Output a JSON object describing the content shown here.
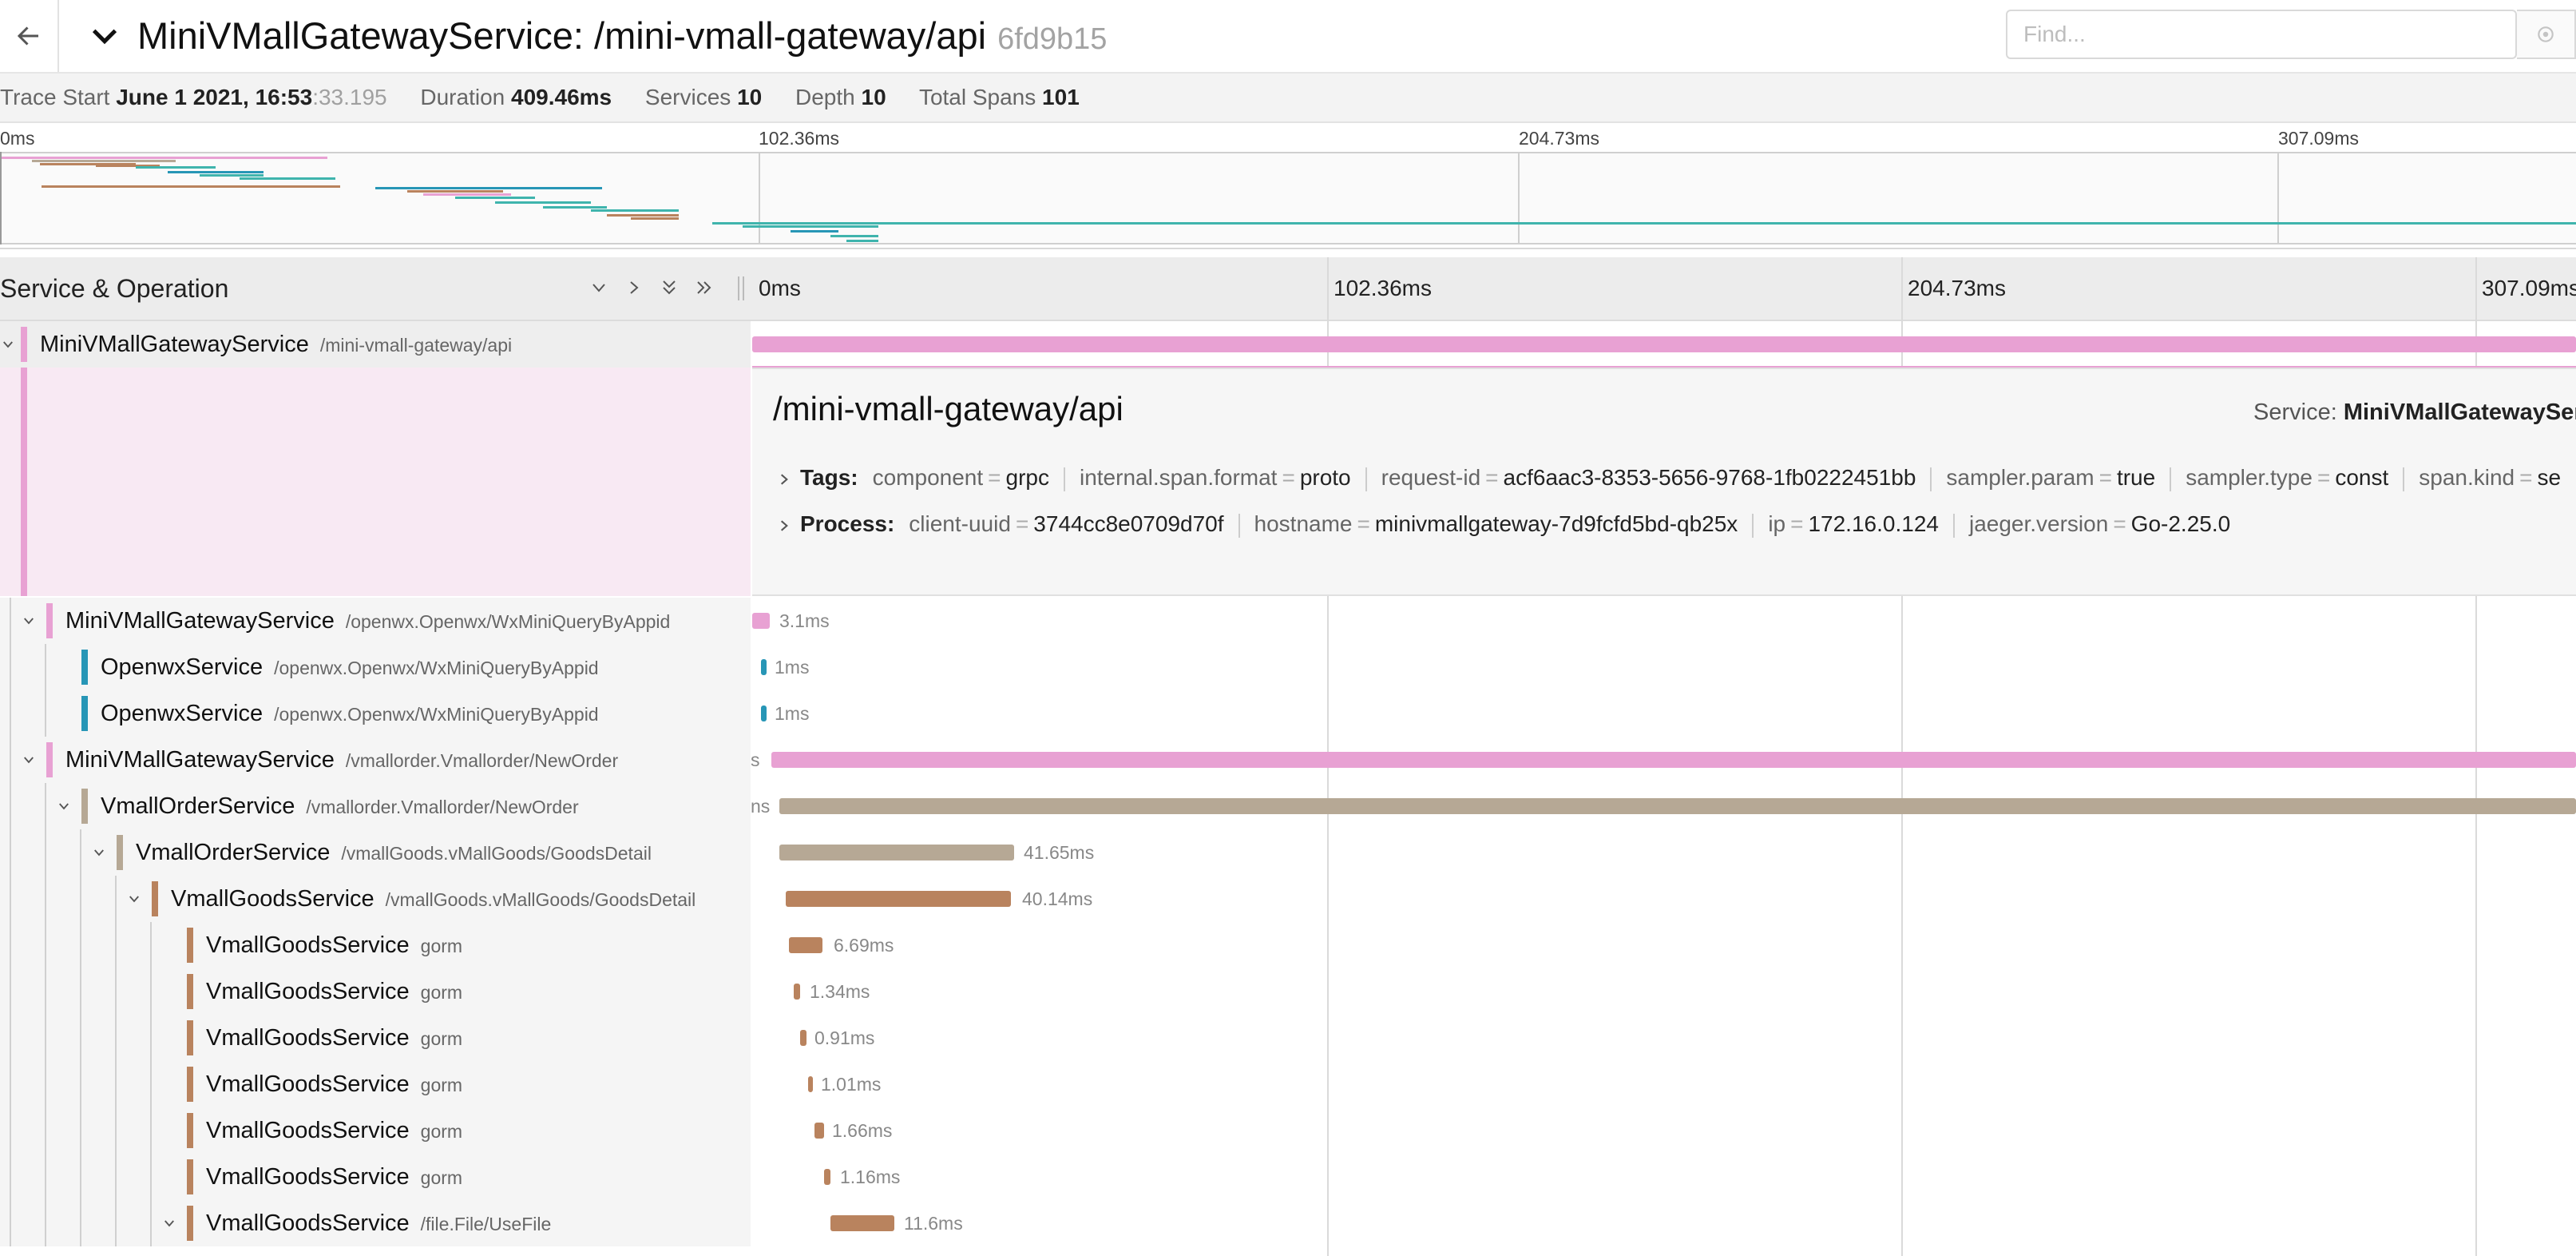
{
  "header": {
    "title": "MiniVMallGatewayService: /mini-vmall-gateway/api",
    "trace_id": "6fd9b15",
    "find_placeholder": "Find..."
  },
  "summary": {
    "trace_start_label": "Trace Start",
    "trace_start_value": "June 1 2021, 16:53",
    "trace_start_ms": ":33.195",
    "duration_label": "Duration",
    "duration_value": "409.46ms",
    "services_label": "Services",
    "services_value": "10",
    "depth_label": "Depth",
    "depth_value": "10",
    "total_spans_label": "Total Spans",
    "total_spans_value": "101"
  },
  "ticks": [
    "0ms",
    "102.36ms",
    "204.73ms",
    "307.09ms"
  ],
  "column_header": {
    "service_operation": "Service & Operation"
  },
  "colors": {
    "gateway": "#e8a1d3",
    "openwx": "#2796b6",
    "order": "#b6a895",
    "goods": "#b9835e",
    "teal": "#3fb4ad"
  },
  "root_row": {
    "service": "MiniVMallGatewayService",
    "operation": "/mini-vmall-gateway/api"
  },
  "detail": {
    "title": "/mini-vmall-gateway/api",
    "service_label": "Service:",
    "service_value": "MiniVMallGatewaySer",
    "tags_label": "Tags:",
    "tags": [
      {
        "k": "component",
        "v": "grpc"
      },
      {
        "k": "internal.span.format",
        "v": "proto"
      },
      {
        "k": "request-id",
        "v": "acf6aac3-8353-5656-9768-1fb0222451bb"
      },
      {
        "k": "sampler.param",
        "v": "true"
      },
      {
        "k": "sampler.type",
        "v": "const"
      },
      {
        "k": "span.kind",
        "v": "se"
      }
    ],
    "process_label": "Process:",
    "process": [
      {
        "k": "client-uuid",
        "v": "3744cc8e0709d70f"
      },
      {
        "k": "hostname",
        "v": "minivmallgateway-7d9fcfd5bd-qb25x"
      },
      {
        "k": "ip",
        "v": "172.16.0.124"
      },
      {
        "k": "jaeger.version",
        "v": "Go-2.25.0"
      }
    ]
  },
  "spans": [
    {
      "service": "MiniVMallGatewayService",
      "operation": "/openwx.Openwx/WxMiniQueryByAppid",
      "duration": "3.1ms",
      "depth": 1,
      "collapsible": true
    },
    {
      "service": "OpenwxService",
      "operation": "/openwx.Openwx/WxMiniQueryByAppid",
      "duration": "1ms",
      "depth": 2,
      "collapsible": false
    },
    {
      "service": "OpenwxService",
      "operation": "/openwx.Openwx/WxMiniQueryByAppid",
      "duration": "1ms",
      "depth": 2,
      "collapsible": false
    },
    {
      "service": "MiniVMallGatewayService",
      "operation": "/vmallorder.Vmallorder/NewOrder",
      "duration": "s",
      "depth": 1,
      "collapsible": true
    },
    {
      "service": "VmallOrderService",
      "operation": "/vmallorder.Vmallorder/NewOrder",
      "duration": "ns",
      "depth": 2,
      "collapsible": true
    },
    {
      "service": "VmallOrderService",
      "operation": "/vmallGoods.vMallGoods/GoodsDetail",
      "duration": "41.65ms",
      "depth": 3,
      "collapsible": true
    },
    {
      "service": "VmallGoodsService",
      "operation": "/vmallGoods.vMallGoods/GoodsDetail",
      "duration": "40.14ms",
      "depth": 4,
      "collapsible": true
    },
    {
      "service": "VmallGoodsService",
      "operation": "gorm",
      "duration": "6.69ms",
      "depth": 5,
      "collapsible": false
    },
    {
      "service": "VmallGoodsService",
      "operation": "gorm",
      "duration": "1.34ms",
      "depth": 5,
      "collapsible": false
    },
    {
      "service": "VmallGoodsService",
      "operation": "gorm",
      "duration": "0.91ms",
      "depth": 5,
      "collapsible": false
    },
    {
      "service": "VmallGoodsService",
      "operation": "gorm",
      "duration": "1.01ms",
      "depth": 5,
      "collapsible": false
    },
    {
      "service": "VmallGoodsService",
      "operation": "gorm",
      "duration": "1.66ms",
      "depth": 5,
      "collapsible": false
    },
    {
      "service": "VmallGoodsService",
      "operation": "gorm",
      "duration": "1.16ms",
      "depth": 5,
      "collapsible": false
    },
    {
      "service": "VmallGoodsService",
      "operation": "/file.File/UseFile",
      "duration": "11.6ms",
      "depth": 5,
      "collapsible": true
    }
  ]
}
